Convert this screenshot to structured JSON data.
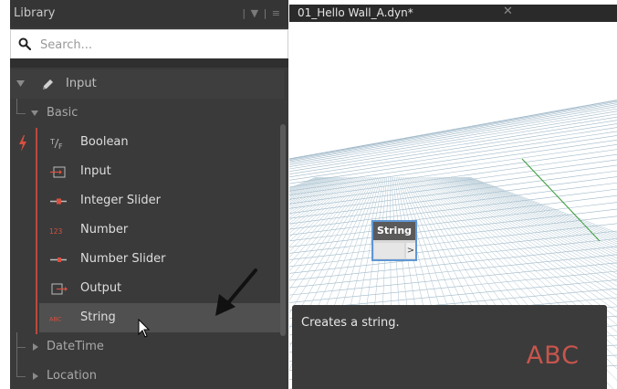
{
  "library": {
    "title": "Library",
    "tools": "| ▼ | ≡",
    "search_placeholder": "Search...",
    "category_input": "Input",
    "subcategory_basic": "Basic",
    "nodes": [
      {
        "label": "Boolean",
        "icon": "boolean-icon"
      },
      {
        "label": "Input",
        "icon": "input-node-icon"
      },
      {
        "label": "Integer Slider",
        "icon": "integer-slider-icon"
      },
      {
        "label": "Number",
        "icon": "number-icon"
      },
      {
        "label": "Number Slider",
        "icon": "number-slider-icon"
      },
      {
        "label": "Output",
        "icon": "output-icon"
      },
      {
        "label": "String",
        "icon": "string-icon",
        "selected": true
      }
    ],
    "category_datetime": "DateTime",
    "category_location": "Location",
    "number_icon_text": "123",
    "string_icon_text": "ABC"
  },
  "canvas": {
    "tab_title": "01_Hello Wall_A.dyn*",
    "tab_close": "✕",
    "node": {
      "title": "String",
      "port": ">"
    }
  },
  "tooltip": {
    "text": "Creates a string.",
    "glyph": "ABC"
  },
  "colors": {
    "panel_bg": "#3a3a3a",
    "accent": "#b84a3e",
    "node_border": "#5f96d4",
    "tooltip_glyph": "#c8554c"
  }
}
